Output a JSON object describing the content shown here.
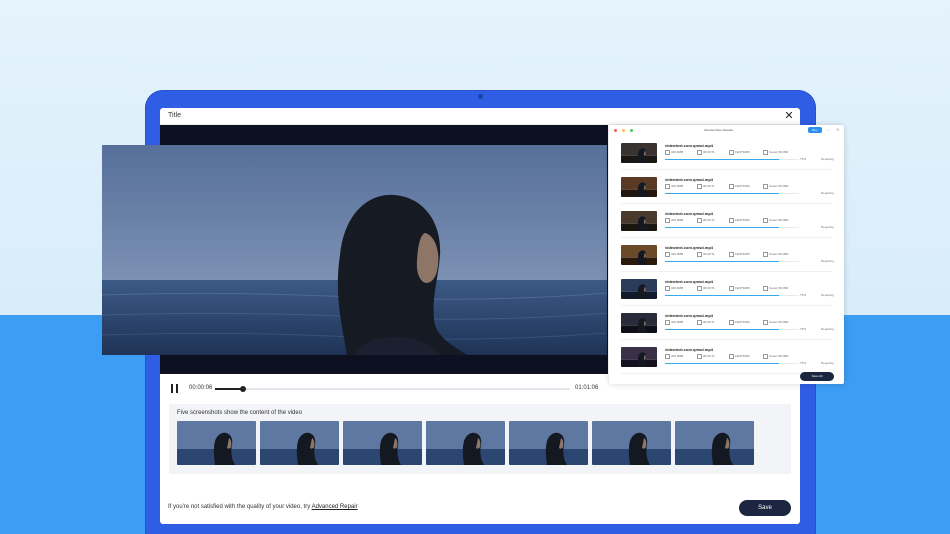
{
  "colors": {
    "accent_blue": "#2f5de3",
    "sky_blue": "#3d9cf3",
    "dark_button": "#1d2640",
    "progress": "#37a8e8"
  },
  "window": {
    "title": "Title",
    "close_icon": "close-icon"
  },
  "player": {
    "current_time": "00:00:06",
    "total_time": "01:01:06",
    "progress_fraction": 0.08
  },
  "screenshots": {
    "label": "Five screenshots show the content of the video",
    "count": 7
  },
  "footer": {
    "hint_prefix": "If you're not satisfied with the quality of your video, try ",
    "hint_link": "Advanced Repair",
    "save_label": "Save"
  },
  "queue": {
    "title": "Wondershare Repairit",
    "badge": "Buy",
    "save_all_label": "Save All",
    "items": [
      {
        "name": "videotext.com.qmsd.mp4",
        "size": "325.9MB",
        "duration": "00:00:71",
        "resolution": "1920*1080",
        "camera": "Canon 5D 800",
        "progress": 0.85,
        "percent": "75%",
        "status": "Repairing"
      },
      {
        "name": "videotext.com.qmsd.mp4",
        "size": "325.9MB",
        "duration": "00:00:71",
        "resolution": "1920*1080",
        "camera": "Canon 5D 800",
        "progress": 0.85,
        "percent": "",
        "status": "Repairing"
      },
      {
        "name": "videotext.com.qmsd.mp4",
        "size": "325.9MB",
        "duration": "00:00:71",
        "resolution": "1920*1080",
        "camera": "Canon 5D 800",
        "progress": 0.85,
        "percent": "",
        "status": "Repairing"
      },
      {
        "name": "videotext.com.qmsd.mp4",
        "size": "325.9MB",
        "duration": "00:00:71",
        "resolution": "1920*1080",
        "camera": "Canon 5D 800",
        "progress": 0.85,
        "percent": "",
        "status": "Repairing"
      },
      {
        "name": "videotext.com.qmsd.mp4",
        "size": "325.9MB",
        "duration": "00:00:71",
        "resolution": "1920*1080",
        "camera": "Canon 5D 800",
        "progress": 0.85,
        "percent": "75%",
        "status": "Repairing"
      },
      {
        "name": "videotext.com.qmsd.mp4",
        "size": "325.9MB",
        "duration": "00:00:71",
        "resolution": "1920*1080",
        "camera": "Canon 5D 800",
        "progress": 0.85,
        "percent": "75%",
        "status": "Repairing"
      },
      {
        "name": "videotext.com.qmsd.mp4",
        "size": "325.9MB",
        "duration": "00:00:71",
        "resolution": "1920*1080",
        "camera": "Canon 5D 800",
        "progress": 0.85,
        "percent": "75%",
        "status": "Repairing"
      }
    ]
  }
}
